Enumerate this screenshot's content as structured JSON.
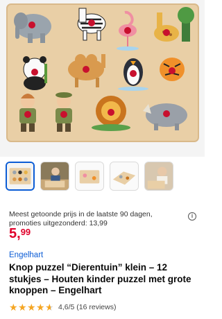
{
  "gallery": {
    "main_image_icon": "wooden-zoo-peg-puzzle",
    "thumbnails": [
      {
        "icon": "puzzle-full-thumbnail",
        "active": true
      },
      {
        "icon": "child-playing-thumbnail",
        "active": false
      },
      {
        "icon": "puzzle-pieces-thumbnail",
        "active": false
      },
      {
        "icon": "puzzle-angle-thumbnail",
        "active": false
      },
      {
        "icon": "toddler-playing-thumbnail",
        "active": false
      }
    ]
  },
  "pricing": {
    "note": "Meest getoonde prijs in de laatste 90 dagen, promoties uitgezonderd: 13,99",
    "price_whole": "5,",
    "price_fraction": "99",
    "price_color": "#e0002a"
  },
  "product": {
    "brand": "Engelhart",
    "title": "Knop puzzel “Dierentuin” klein – 12 stukjes – Houten kinder puzzel met grote knoppen – Engelhart"
  },
  "rating": {
    "value": 4.6,
    "text": "4,6/5 (16 reviews)",
    "star_color": "#f5a623"
  },
  "colors": {
    "link_blue": "#0b5cd5",
    "thumb_active_border": "#0b5cd5"
  }
}
